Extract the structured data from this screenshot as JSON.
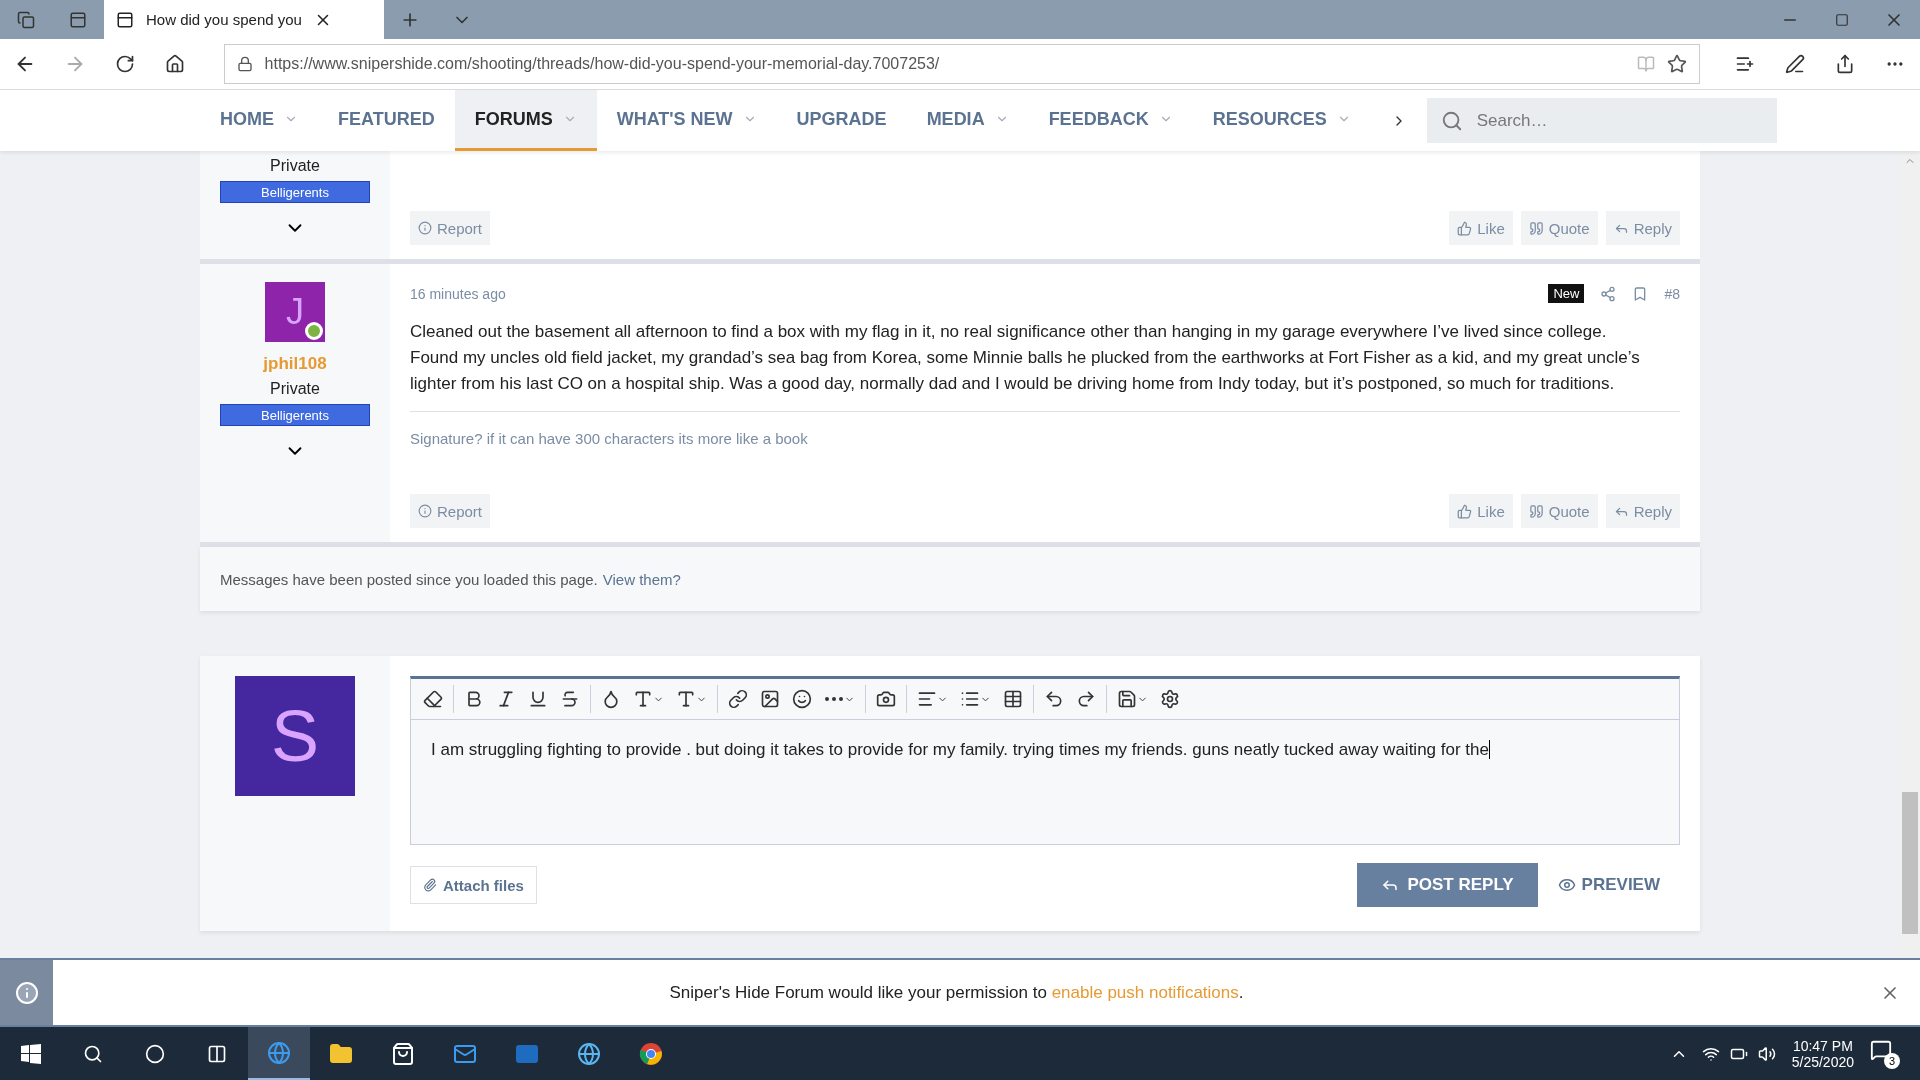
{
  "browser": {
    "tab_title": "How did you spend you",
    "url": "https://www.snipershide.com/shooting/threads/how-did-you-spend-your-memorial-day.7007253/"
  },
  "nav": {
    "items": [
      {
        "label": "HOME",
        "selected": false,
        "dropdown": true
      },
      {
        "label": "FEATURED",
        "selected": false,
        "dropdown": false
      },
      {
        "label": "FORUMS",
        "selected": true,
        "dropdown": true
      },
      {
        "label": "WHAT'S NEW",
        "selected": false,
        "dropdown": true
      },
      {
        "label": "UPGRADE",
        "selected": false,
        "dropdown": false
      },
      {
        "label": "MEDIA",
        "selected": false,
        "dropdown": true
      },
      {
        "label": "FEEDBACK",
        "selected": false,
        "dropdown": true
      },
      {
        "label": "RESOURCES",
        "selected": false,
        "dropdown": true
      }
    ],
    "search": {
      "placeholder": "Search…"
    }
  },
  "posts": [
    {
      "rank": "Private",
      "banner": "Belligerents",
      "report": "Report",
      "actions": [
        "Like",
        "Quote",
        "Reply"
      ]
    },
    {
      "avatar_letter": "J",
      "online": true,
      "username": "jphil108",
      "rank": "Private",
      "banner": "Belligerents",
      "time": "16 minutes ago",
      "badge": "New",
      "number": "#8",
      "body": "Cleaned out the basement all afternoon to find a box with my flag in it, no real significance other than hanging in my garage everywhere I’ve lived since college. Found my uncles old field jacket, my grandad’s sea bag from Korea, some Minnie balls he plucked from the earthworks at Fort Fisher as a kid, and my great uncle’s lighter from his last CO on a hospital ship. Was a good day, normally dad and I would be driving home from Indy today, but it’s postponed, so much for traditions.",
      "signature": "Signature? if it can have 300 characters its more like a book",
      "report": "Report",
      "actions": [
        "Like",
        "Quote",
        "Reply"
      ]
    }
  ],
  "notice": {
    "text": "Messages have been posted since you loaded this page.",
    "link": "View them?"
  },
  "editor": {
    "avatar_letter": "S",
    "value": "I am struggling fighting to provide . but doing it takes to provide for my family. trying times my friends. guns neatly tucked away waiting  for the",
    "attach": "Attach files",
    "post": "POST REPLY",
    "preview": "PREVIEW"
  },
  "push": {
    "text": "Sniper's Hide Forum would like your permission to",
    "link": "enable push notifications",
    "end": "."
  },
  "taskbar": {
    "time": "10:47 PM",
    "date": "5/25/2020",
    "notifications": "3"
  }
}
